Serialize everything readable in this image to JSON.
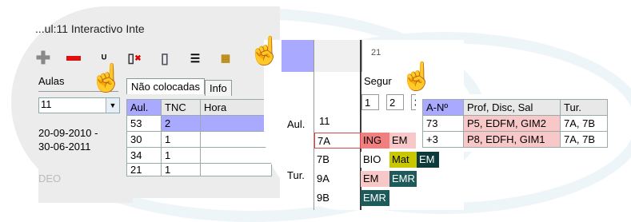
{
  "window": {
    "title": "...ul:11  Interactivo Inte"
  },
  "toolbar": {
    "icons": [
      "plus-icon",
      "minus-icon",
      "stamp-icon",
      "door-delete-icon",
      "door-icon",
      "list-icon",
      "calendar-icon"
    ]
  },
  "left_panel": {
    "label": "Aulas",
    "combo_value": "11",
    "date_start": "20-09-2010 -",
    "date_end": "30-06-2011",
    "faded_text": "DEO"
  },
  "tabs": {
    "active": "Não colocadas",
    "other": "Info"
  },
  "unplaced_table": {
    "headers": [
      "Aul.",
      "TNC",
      "Hora"
    ],
    "rows": [
      [
        "53",
        "2",
        ""
      ],
      [
        "30",
        "1",
        ""
      ],
      [
        "34",
        "1",
        ""
      ],
      [
        "21",
        "1",
        ""
      ]
    ]
  },
  "schedule": {
    "day": "Segur",
    "cols": [
      "1",
      "2",
      "3"
    ],
    "row_headers": {
      "aul": "Aul.",
      "tur": "Tur."
    },
    "aul_value": "11",
    "rows": [
      {
        "class": "7A",
        "cells": [
          "ING",
          "EM",
          ""
        ]
      },
      {
        "class": "7B",
        "cells": [
          "BIO",
          "Mat",
          "EM"
        ]
      },
      {
        "class": "9A",
        "cells": [
          "EM",
          "EMR",
          ""
        ]
      },
      {
        "class": "9B",
        "cells": [
          "EMR",
          "",
          ""
        ]
      }
    ],
    "field_hint": "21"
  },
  "detail_table": {
    "headers": [
      "A-Nº",
      "Prof, Disc, Sal",
      "Tur."
    ],
    "rows": [
      [
        "73",
        "P5, EDFM, GIM2",
        "7A, 7B"
      ],
      [
        "+3",
        "P8, EDFH, GIM1",
        "7A, 7B"
      ]
    ]
  },
  "colors": {
    "selection": "#a9a9ff",
    "red_cell": "#f08080",
    "pink_cell": "#f8c8c8",
    "hand": "#1a3ea8"
  }
}
